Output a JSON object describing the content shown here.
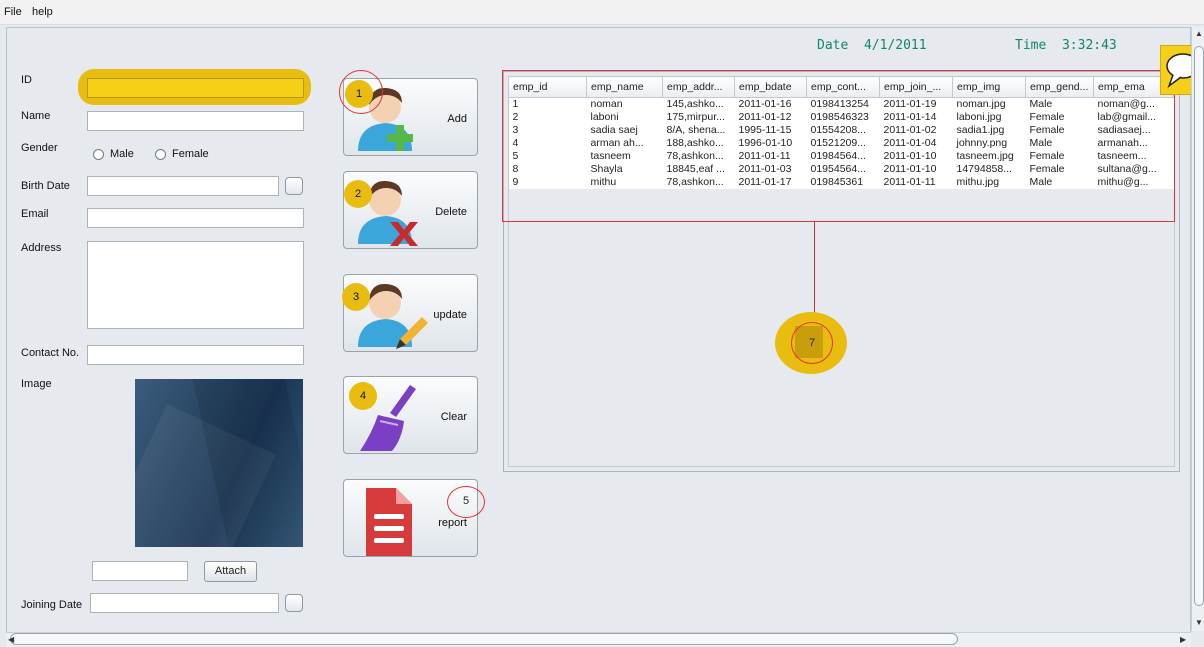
{
  "menu": [
    "File",
    "help"
  ],
  "header": {
    "date_label": "Date",
    "date_value": "4/1/2011",
    "time_label": "Time",
    "time_value": "3:32:43"
  },
  "form": {
    "id_label": "ID",
    "name_label": "Name",
    "gender_label": "Gender",
    "gender_options": [
      "Male",
      "Female"
    ],
    "birth_date_label": "Birth Date",
    "email_label": "Email",
    "address_label": "Address",
    "contact_label": "Contact No.",
    "image_label": "Image",
    "attach_label": "Attach",
    "joining_date_label": "Joining Date"
  },
  "actions": [
    {
      "label": "Add",
      "marker": "1",
      "icon": "add-user-icon"
    },
    {
      "label": "Delete",
      "marker": "2",
      "icon": "delete-user-icon"
    },
    {
      "label": "update",
      "marker": "3",
      "icon": "edit-user-icon"
    },
    {
      "label": "Clear",
      "marker": "4",
      "icon": "broom-icon"
    },
    {
      "label": "report",
      "marker": "5",
      "icon": "document-icon"
    }
  ],
  "table": {
    "columns": [
      "emp_id",
      "emp_name",
      "emp_addr...",
      "emp_bdate",
      "emp_cont...",
      "emp_join_...",
      "emp_img",
      "emp_gend...",
      "emp_ema"
    ],
    "rows": [
      [
        "1",
        "noman",
        "145,ashko...",
        "2011-01-16",
        "0198413254",
        "2011-01-19",
        "noman.jpg",
        "Male",
        "noman@g..."
      ],
      [
        "2",
        "laboni",
        "175,mirpur...",
        "2011-01-12",
        "0198546323",
        "2011-01-14",
        "laboni.jpg",
        "Female",
        "lab@gmail..."
      ],
      [
        "3",
        "sadia saej",
        "8/A, shena...",
        "1995-11-15",
        "01554208...",
        "2011-01-02",
        "sadia1.jpg",
        "Female",
        "sadiasaej..."
      ],
      [
        "4",
        "arman ah...",
        "188,ashko...",
        "1996-01-10",
        "01521209...",
        "2011-01-04",
        "johnny.png",
        "Male",
        "armanah..."
      ],
      [
        "5",
        "tasneem",
        "78,ashkon...",
        "2011-01-11",
        "01984564...",
        "2011-01-10",
        "tasneem.jpg",
        "Female",
        "tasneem..."
      ],
      [
        "8",
        "Shayla",
        "18845,eaf ...",
        "2011-01-03",
        "01954564...",
        "2011-01-10",
        "14794858...",
        "Female",
        "sultana@g..."
      ],
      [
        "9",
        "mithu",
        "78,ashkon...",
        "2011-01-17",
        "019845361",
        "2011-01-11",
        "mithu.jpg",
        "Male",
        "mithu@g..."
      ]
    ]
  },
  "annotation": {
    "marker": "7"
  },
  "colors": {
    "highlight": "#e8bd10",
    "annotation_red": "#e0353a",
    "clock_text": "#12856d"
  }
}
